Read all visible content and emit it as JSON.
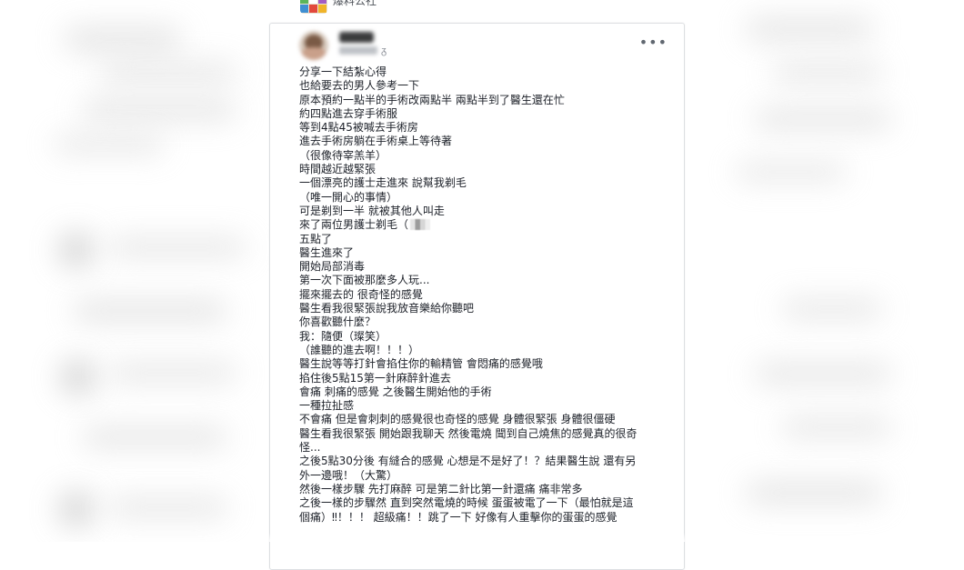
{
  "group": {
    "name": "爆料公社",
    "avatar_icon": "group-avatar-icon"
  },
  "post": {
    "privacy_icon": "friends-icon",
    "more_icon": "more-options-icon",
    "more_label": "•••",
    "lines": [
      "分享一下結紮心得",
      "也給要去的男人參考一下",
      "原本預約一點半的手術改兩點半 兩點半到了醫生還在忙",
      "約四點進去穿手術服",
      "等到4點45被喊去手術房",
      "進去手術房躺在手術桌上等待著",
      "（很像待宰羔羊）",
      "時間越近越緊張",
      "一個漂亮的護士走進來 說幫我剃毛",
      "（唯一開心的事情）",
      "可是剃到一半 就被其他人叫走",
      "來了兩位男護士剃毛（",
      "五點了",
      "醫生進來了",
      "開始局部消毒",
      "第一次下面被那麼多人玩...",
      "擺來擺去的 很奇怪的感覺",
      "醫生看我很緊張說我放音樂給你聽吧",
      "你喜歡聽什麼？",
      "我：隨便（璨笑）",
      "（誰聽的進去啊！！！）",
      "醫生說等等打針會掐住你的輸精管 會悶痛的感覺哦",
      "掐住後5點15第一針麻醉針進去",
      "會痛 刺痛的感覺 之後醫生開始他的手術",
      "一種拉扯感",
      "不會痛 但是會刺刺的感覺很也奇怪的感覺 身體很緊張 身體很僵硬",
      "醫生看我很緊張 開始跟我聊天 然後電燒 聞到自己燒焦的感覺真的很奇",
      "怪...",
      "之後5點30分後 有縫合的感覺 心想是不是好了！？結果醫生說 還有另",
      "外一邊哦！（大驚）",
      "然後一樣步驟 先打麻醉 可是第二針比第一針還痛 痛非常多",
      "之後一樣的步驟然 直到突然電燒的時候 蛋蛋被電了一下（最怕就是這",
      "個痛）‼！！！ 超級痛！！跳了一下 好像有人重擊你的蛋蛋的感覺"
    ]
  }
}
